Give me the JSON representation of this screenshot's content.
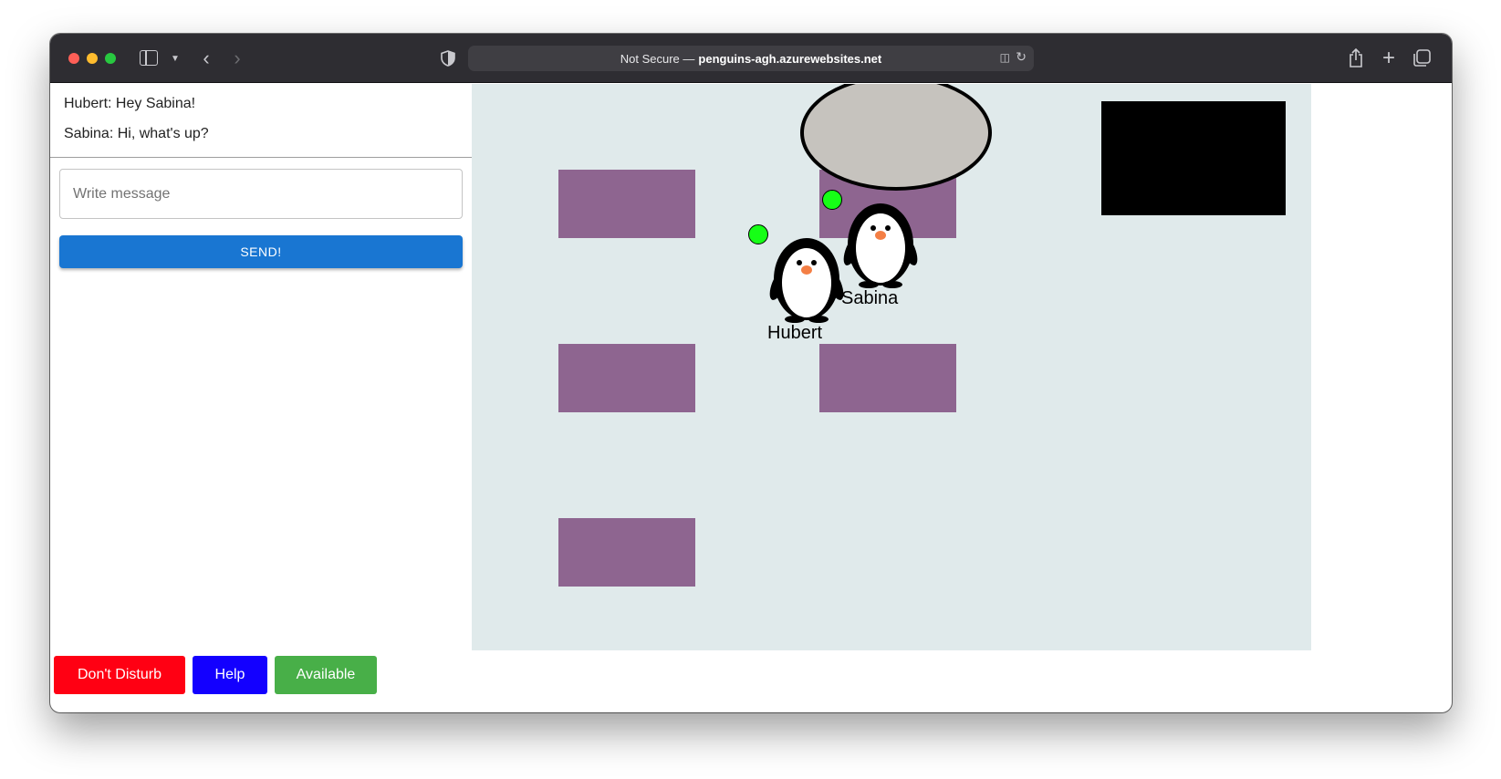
{
  "browser": {
    "address_prefix": "Not Secure —",
    "address_host": "penguins-agh.azurewebsites.net"
  },
  "chat": {
    "messages": [
      {
        "text": "Hubert: Hey Sabina!"
      },
      {
        "text": "Sabina: Hi, what's up?"
      }
    ],
    "input_placeholder": "Write message",
    "input_value": "",
    "send_label": "SEND!"
  },
  "game": {
    "players": [
      {
        "name": "Hubert",
        "status_color": "#16ff16"
      },
      {
        "name": "Sabina",
        "status_color": "#16ff16"
      }
    ],
    "colors": {
      "floor": "#e0eaeb",
      "desk": "#8e6590",
      "round_table": "#c6c3be",
      "board": "#000000"
    }
  },
  "status_buttons": {
    "dnd_label": "Don't Disturb",
    "help_label": "Help",
    "available_label": "Available",
    "colors": {
      "dnd": "#ff0013",
      "help": "#1300ff",
      "available": "#48af48"
    }
  }
}
